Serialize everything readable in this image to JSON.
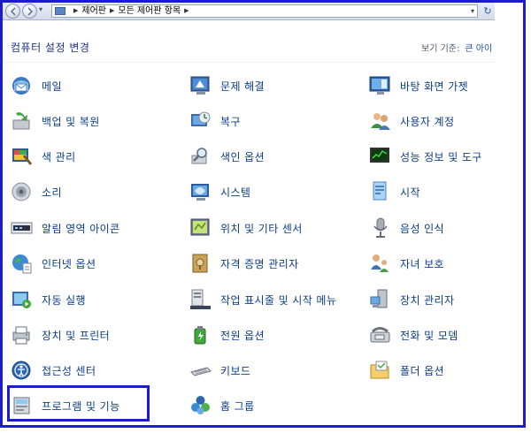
{
  "address": {
    "crumbs": [
      "제어판",
      "모든 제어판 항목"
    ]
  },
  "heading": "컴퓨터 설정 변경",
  "viewby": {
    "label": "보기 기준:",
    "value": "큰 아이"
  },
  "items": [
    {
      "label": "메일",
      "icon": "mail-icon"
    },
    {
      "label": "문제 해결",
      "icon": "troubleshoot-icon"
    },
    {
      "label": "바탕 화면 가젯",
      "icon": "desktop-gadgets-icon"
    },
    {
      "label": "백업 및 복원",
      "icon": "backup-restore-icon"
    },
    {
      "label": "복구",
      "icon": "recovery-icon"
    },
    {
      "label": "사용자 계정",
      "icon": "user-accounts-icon"
    },
    {
      "label": "색 관리",
      "icon": "color-management-icon"
    },
    {
      "label": "색인 옵션",
      "icon": "indexing-options-icon"
    },
    {
      "label": "성능 정보 및 도구",
      "icon": "performance-icon"
    },
    {
      "label": "소리",
      "icon": "sound-icon"
    },
    {
      "label": "시스템",
      "icon": "system-icon"
    },
    {
      "label": "시작",
      "icon": "getting-started-icon"
    },
    {
      "label": "알림 영역 아이콘",
      "icon": "notification-area-icon"
    },
    {
      "label": "위치 및 기타 센서",
      "icon": "location-sensors-icon"
    },
    {
      "label": "음성 인식",
      "icon": "speech-recognition-icon"
    },
    {
      "label": "인터넷 옵션",
      "icon": "internet-options-icon"
    },
    {
      "label": "자격 증명 관리자",
      "icon": "credential-manager-icon"
    },
    {
      "label": "자녀 보호",
      "icon": "parental-controls-icon"
    },
    {
      "label": "자동 실행",
      "icon": "autoplay-icon"
    },
    {
      "label": "작업 표시줄 및 시작 메뉴",
      "icon": "taskbar-icon"
    },
    {
      "label": "장치 관리자",
      "icon": "device-manager-icon"
    },
    {
      "label": "장치 및 프린터",
      "icon": "devices-printers-icon"
    },
    {
      "label": "전원 옵션",
      "icon": "power-options-icon"
    },
    {
      "label": "전화 및 모뎀",
      "icon": "phone-modem-icon"
    },
    {
      "label": "접근성 센터",
      "icon": "ease-of-access-icon"
    },
    {
      "label": "키보드",
      "icon": "keyboard-icon"
    },
    {
      "label": "폴더 옵션",
      "icon": "folder-options-icon"
    },
    {
      "label": "프로그램 및 기능",
      "icon": "programs-features-icon"
    },
    {
      "label": "홈 그룹",
      "icon": "homegroup-icon"
    }
  ]
}
